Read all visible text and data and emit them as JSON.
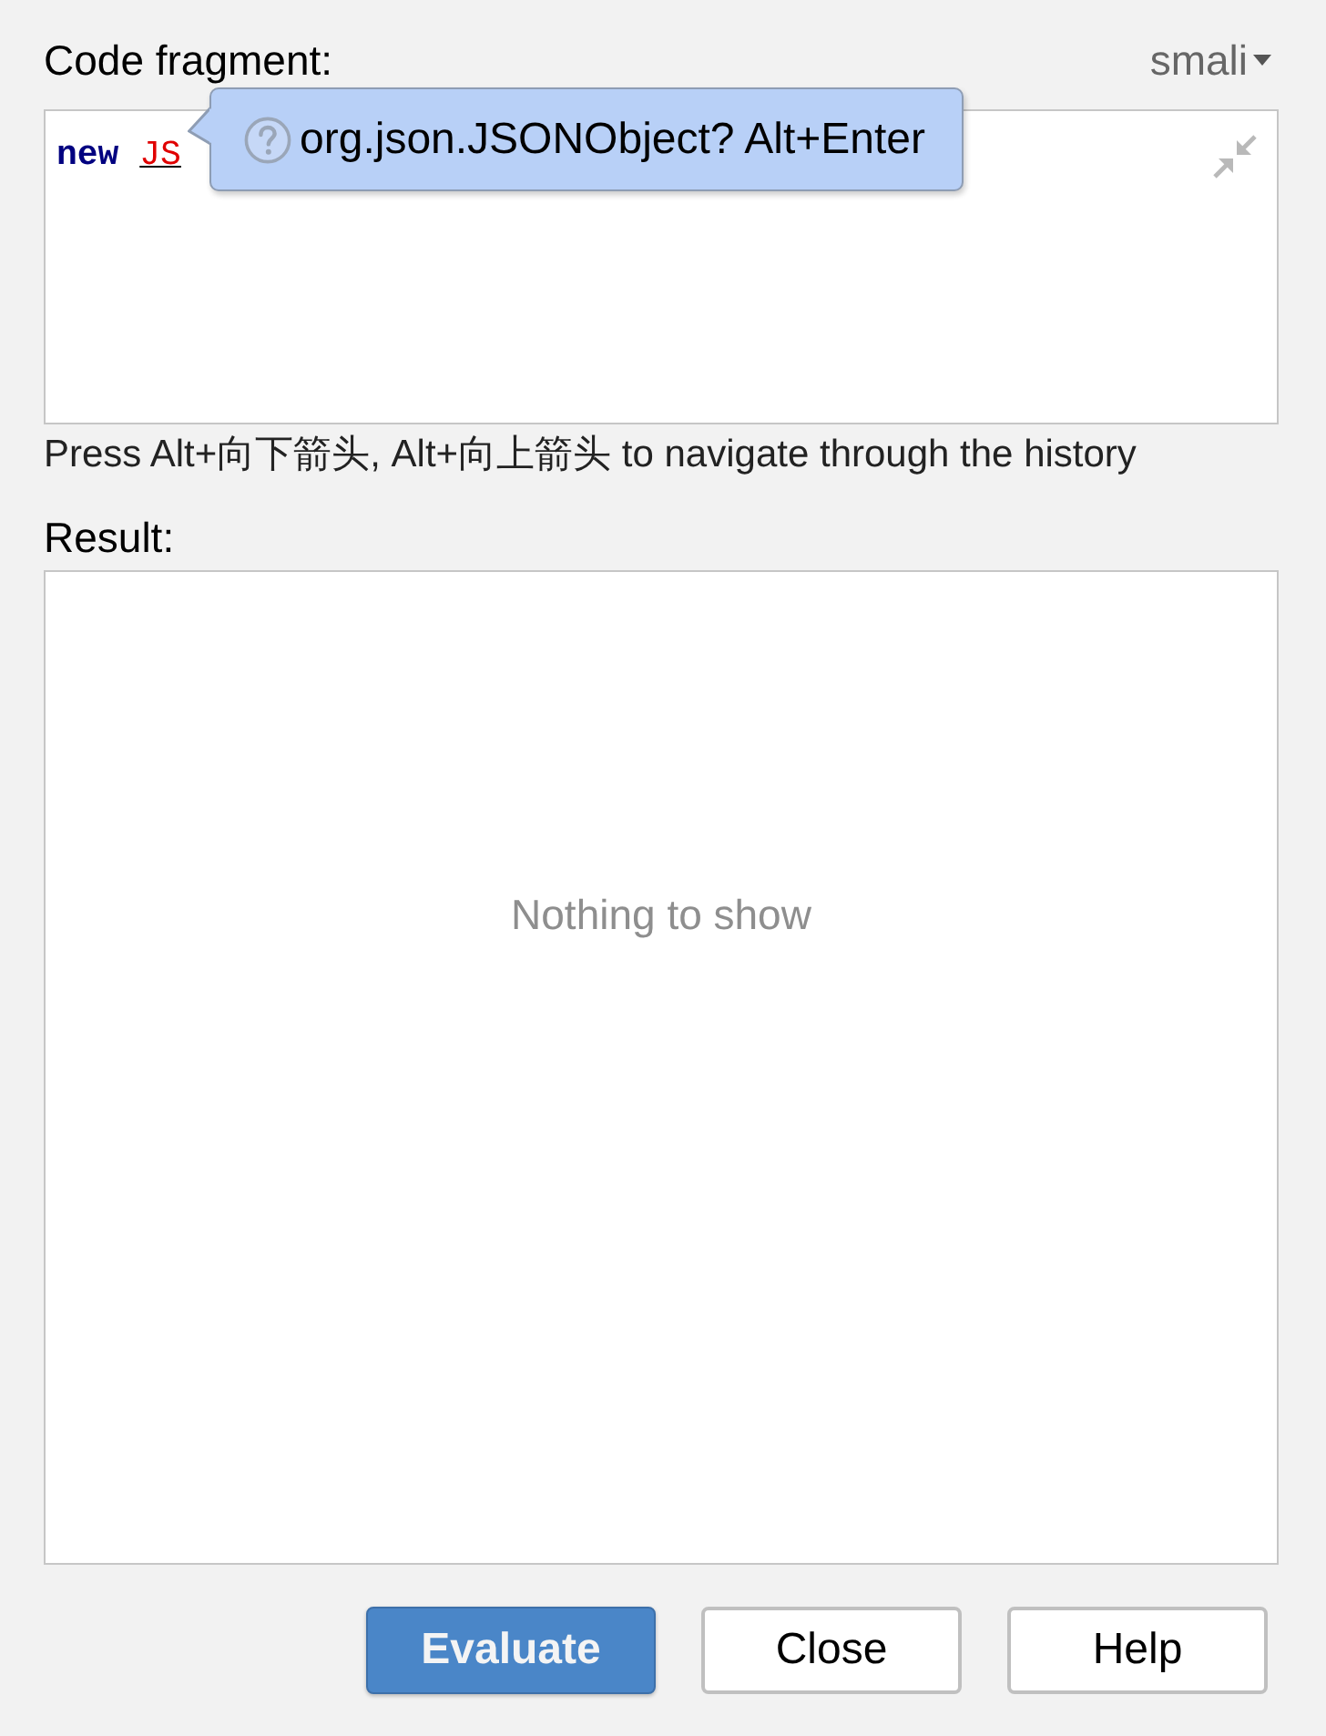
{
  "code_fragment": {
    "label": "Code fragment:",
    "language": "smali",
    "tokens": [
      {
        "text": "new",
        "kind": "keyword"
      },
      {
        "text": "JS",
        "kind": "error"
      }
    ]
  },
  "import_hint": {
    "text": "org.json.JSONObject? Alt+Enter"
  },
  "history_hint": "Press Alt+向下箭头, Alt+向上箭头 to navigate through the history",
  "result": {
    "label": "Result:",
    "empty_text": "Nothing to show"
  },
  "buttons": [
    {
      "label": "Evaluate",
      "kind": "primary"
    },
    {
      "label": "Close",
      "kind": "default"
    },
    {
      "label": "Help",
      "kind": "default"
    }
  ]
}
